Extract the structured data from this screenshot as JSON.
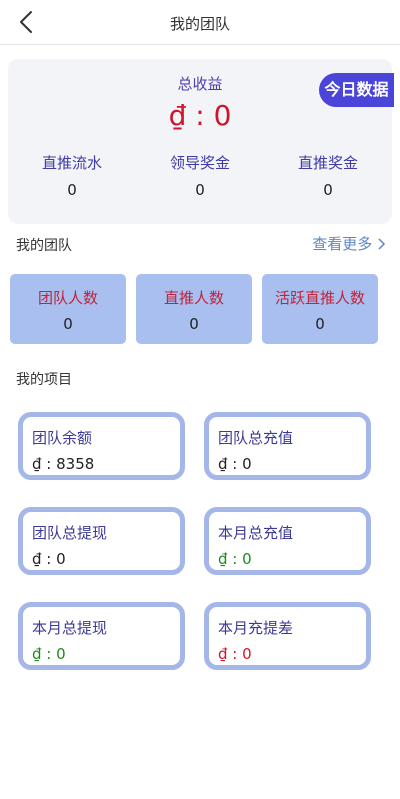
{
  "header": {
    "title": "我的团队"
  },
  "summary": {
    "label": "总收益",
    "value": "₫ : 0",
    "today_button": "今日数据",
    "stats": [
      {
        "label": "直推流水",
        "value": "0"
      },
      {
        "label": "领导奖金",
        "value": "0"
      },
      {
        "label": "直推奖金",
        "value": "0"
      }
    ]
  },
  "team": {
    "title": "我的团队",
    "more_link": "查看更多",
    "cards": [
      {
        "label": "团队人数",
        "value": "0"
      },
      {
        "label": "直推人数",
        "value": "0"
      },
      {
        "label": "活跃直推人数",
        "value": "0"
      }
    ]
  },
  "projects": {
    "title": "我的项目",
    "cards": [
      {
        "label": "团队余额",
        "value": "₫ : 8358",
        "tone": "black"
      },
      {
        "label": "团队总充值",
        "value": "₫ : 0",
        "tone": "black"
      },
      {
        "label": "团队总提现",
        "value": "₫ : 0",
        "tone": "black"
      },
      {
        "label": "本月总充值",
        "value": "₫ : 0",
        "tone": "green"
      },
      {
        "label": "本月总提现",
        "value": "₫ : 0",
        "tone": "green"
      },
      {
        "label": "本月充提差",
        "value": "₫ : 0",
        "tone": "red"
      }
    ]
  },
  "colors": {
    "accent": "#4b44d8",
    "card_fill": "#a8bff0",
    "card_border": "#a5b7e8",
    "value_red": "#d0142c",
    "value_green": "#1c8a1c"
  },
  "icons": {
    "back": "back-chevron-icon",
    "more": "chevron-right-icon"
  }
}
